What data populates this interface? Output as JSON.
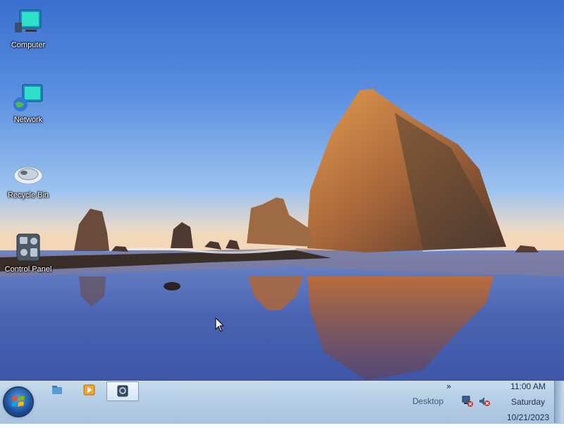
{
  "desktop": {
    "icons": [
      {
        "label": "Computer",
        "icon": "computer-icon"
      },
      {
        "label": "Network",
        "icon": "network-icon"
      },
      {
        "label": "Recycle Bin",
        "icon": "recycle-bin-icon"
      },
      {
        "label": "Control Panel",
        "icon": "control-panel-icon"
      }
    ]
  },
  "taskbar": {
    "start": {
      "icon": "start-orb-icon"
    },
    "pinned": [
      {
        "name": "explorer",
        "icon": "folder-icon",
        "active": false
      },
      {
        "name": "media-player",
        "icon": "media-play-icon",
        "active": false
      },
      {
        "name": "screenshot-app",
        "icon": "app-window-icon",
        "active": true
      }
    ],
    "tray": {
      "overflow_label": "»",
      "desktop_label": "Desktop",
      "network_icon": "network-disconnected-icon",
      "volume_icon": "volume-muted-icon"
    },
    "clock": {
      "time": "11:00 AM",
      "day": "Saturday",
      "date": "10/21/2023"
    }
  }
}
